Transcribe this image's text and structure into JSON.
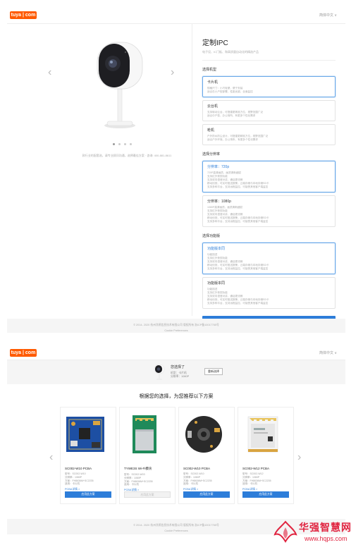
{
  "header": {
    "logo": "tuya | com",
    "language": "简体中文 ∨"
  },
  "product": {
    "caption": "款行业的配套选，请专业顾问沟通，选择最佳方案 · 咨询: 400-881-8611",
    "carousel_total": 4,
    "carousel_active": 1
  },
  "config": {
    "title": "定制IPC",
    "subtitle": "电子设、IC门板、和高质量自动化的精选产品",
    "sections": [
      {
        "label": "选择机型",
        "options": [
          {
            "title": "卡片机",
            "lines": [
              "规格尺寸：小巧轻便，便于安装",
              "适合在小户型部署，性能优越，全面监控"
            ],
            "selected": true
          },
          {
            "title": "云台机",
            "lines": [
              "支持转动云台，可搭建更精准方位，视野范围广泛",
              "适合中户型，办公场所，有更多个性化需求"
            ],
            "selected": false
          },
          {
            "title": "枪机",
            "lines": [
              "户外防水防尘设计，可搭建更精准方位，视野范围广泛",
              "适合户外环境，办公场所，有更多个性化需求"
            ],
            "selected": false
          }
        ]
      },
      {
        "label": "选择分辨率",
        "options": [
          {
            "title": "分辨率：720p",
            "blue": true,
            "lines": [
              "720P高清画质，画质清晰细腻",
              "支持红外夜视功能",
              "支持双向语音对讲，通话更流畅",
              "移动侦测，可实时推送报警，云端存储与本地存储SD卡",
              "支持多种平台，支持远程监控，可接受其他客户端监控"
            ],
            "selected": true
          },
          {
            "title": "分辨率：1080p",
            "blue": false,
            "lines": [
              "1080P高清画质，画质清晰细腻",
              "支持红外夜视功能",
              "支持双向语音对讲，通话更流畅",
              "移动侦测，可实时推送报警，云端存储与本地存储SD卡",
              "支持多种平台，支持远程监控，可接受其他客户端监控"
            ],
            "selected": false
          }
        ]
      },
      {
        "label": "选择功能版",
        "options": [
          {
            "title": "功能版本同",
            "blue": true,
            "lines": [
              "功能描述",
              "支持红外夜视功能",
              "支持双向语音对讲，通话更流畅",
              "移动侦测，可实时推送报警，云端存储与本地存储SD卡",
              "支持多种平台，支持远程监控，可接受其他客户端监控"
            ],
            "selected": true
          },
          {
            "title": "功能版本同",
            "blue": false,
            "lines": [
              "功能描述",
              "支持红外夜视功能",
              "支持双向语音对讲，通话更流畅",
              "移动侦测，可实时推送报警，云端存储与本地存储SD卡",
              "支持多种平台，支持远程监控，可接受其他客户端监控"
            ],
            "selected": false
          }
        ]
      }
    ],
    "view_button": "查看PCBA方案"
  },
  "footer": {
    "copyright": "© 2014- 2020 杭州涂鸦信息技术有限公司 版权所有 浙ICP备10017765号",
    "cookie": "Cookie Preferences"
  },
  "selection": {
    "title": "您选择了",
    "lines": [
      "机型：卡片机",
      "分辨率：1080P"
    ],
    "reselect": "重新选择"
  },
  "recommend": {
    "title": "根据您的选择，为您推荐以下方案",
    "cards": [
      {
        "name": "SC002-W10 PCBA",
        "lines": [
          "型号：SC002-W10",
          "分辨率：1080P",
          "方案：FH8636M+SC2235",
          "适用：卡片机"
        ],
        "link": "PCBA详情 >",
        "button": "应用此方案",
        "enabled": true,
        "image": "blue-pcb"
      },
      {
        "name": "TYWE3S Wi-Fi模块",
        "lines": [
          "型号：SC002-W03",
          "分辨率：1080P",
          "方案：FH8636M+SC2235",
          "适用：卡片机"
        ],
        "link": "PCBA详情 >",
        "button": "应用此方案",
        "enabled": false,
        "image": "green-module"
      },
      {
        "name": "SC002-W10 PCBA",
        "lines": [
          "型号：SC002-W10",
          "分辨率：1080P",
          "方案：FH8636M+SC2235",
          "适用：卡片机"
        ],
        "link": "PCBA详情 >",
        "button": "应用此方案",
        "enabled": true,
        "image": "round-pcb"
      },
      {
        "name": "SC002-W12 PCBA",
        "lines": [
          "型号：SC002-W12",
          "分辨率：1080P",
          "方案：FH8636M+SC2235",
          "适用：卡片机"
        ],
        "link": "PCBA详情 >",
        "button": "应用此方案",
        "enabled": true,
        "image": "white-module"
      }
    ]
  },
  "watermark": {
    "text": "华强智慧网",
    "url": "www.hqps.com"
  }
}
